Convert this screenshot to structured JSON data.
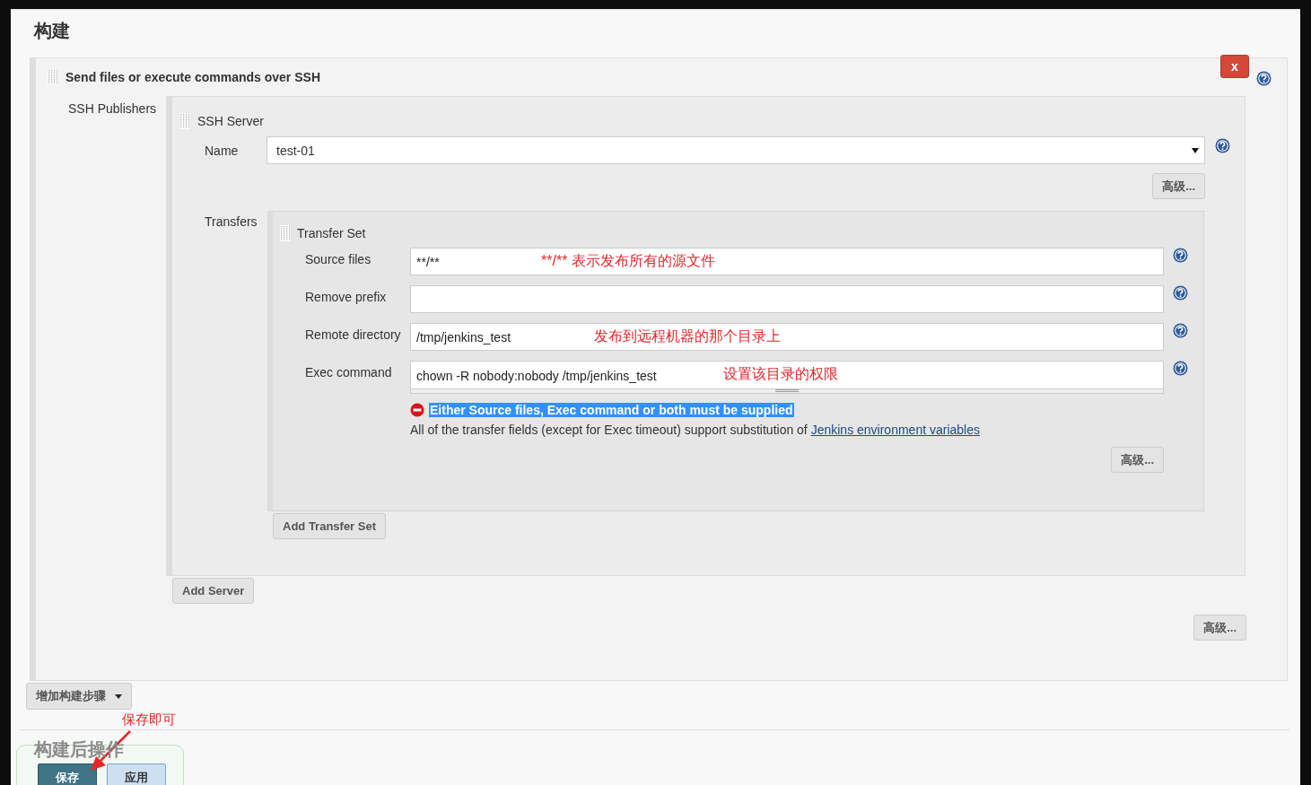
{
  "section_title": "构建",
  "step": {
    "title": "Send files or execute commands over SSH",
    "delete_label": "x",
    "publishers_label": "SSH Publishers",
    "server": {
      "title": "SSH Server",
      "name_label": "Name",
      "name_value": "test-01",
      "advanced": "高级...",
      "transfers_label": "Transfers",
      "transfer_set": {
        "title": "Transfer Set",
        "fields": [
          {
            "kind": "input",
            "label": "Source files",
            "value": "**/**",
            "note": "**/** 表示发布所有的源文件"
          },
          {
            "kind": "input",
            "label": "Remove prefix"
          },
          {
            "kind": "input",
            "label": "Remote directory",
            "value": "/tmp/jenkins_test",
            "note": "发布到远程机器的那个目录上"
          },
          {
            "kind": "textarea",
            "label": "Exec command",
            "value": "chown -R nobody:nobody /tmp/jenkins_test",
            "note": "设置该目录的权限"
          }
        ],
        "error": "Either Source files, Exec command or both must be supplied",
        "info": "All of the transfer fields (except for Exec timeout) support substitution of",
        "info_link": "Jenkins environment variables",
        "advanced": "高级..."
      },
      "add_transfer": "Add Transfer Set"
    },
    "add_server": "Add Server",
    "advanced": "高级..."
  },
  "add_step": "增加构建步骤",
  "next_section_title": "构建后操作",
  "save_note": "保存即可",
  "buttons": [
    {
      "kind": "primary",
      "label": "保存"
    },
    {
      "kind": "secondary",
      "label": "应用"
    }
  ]
}
